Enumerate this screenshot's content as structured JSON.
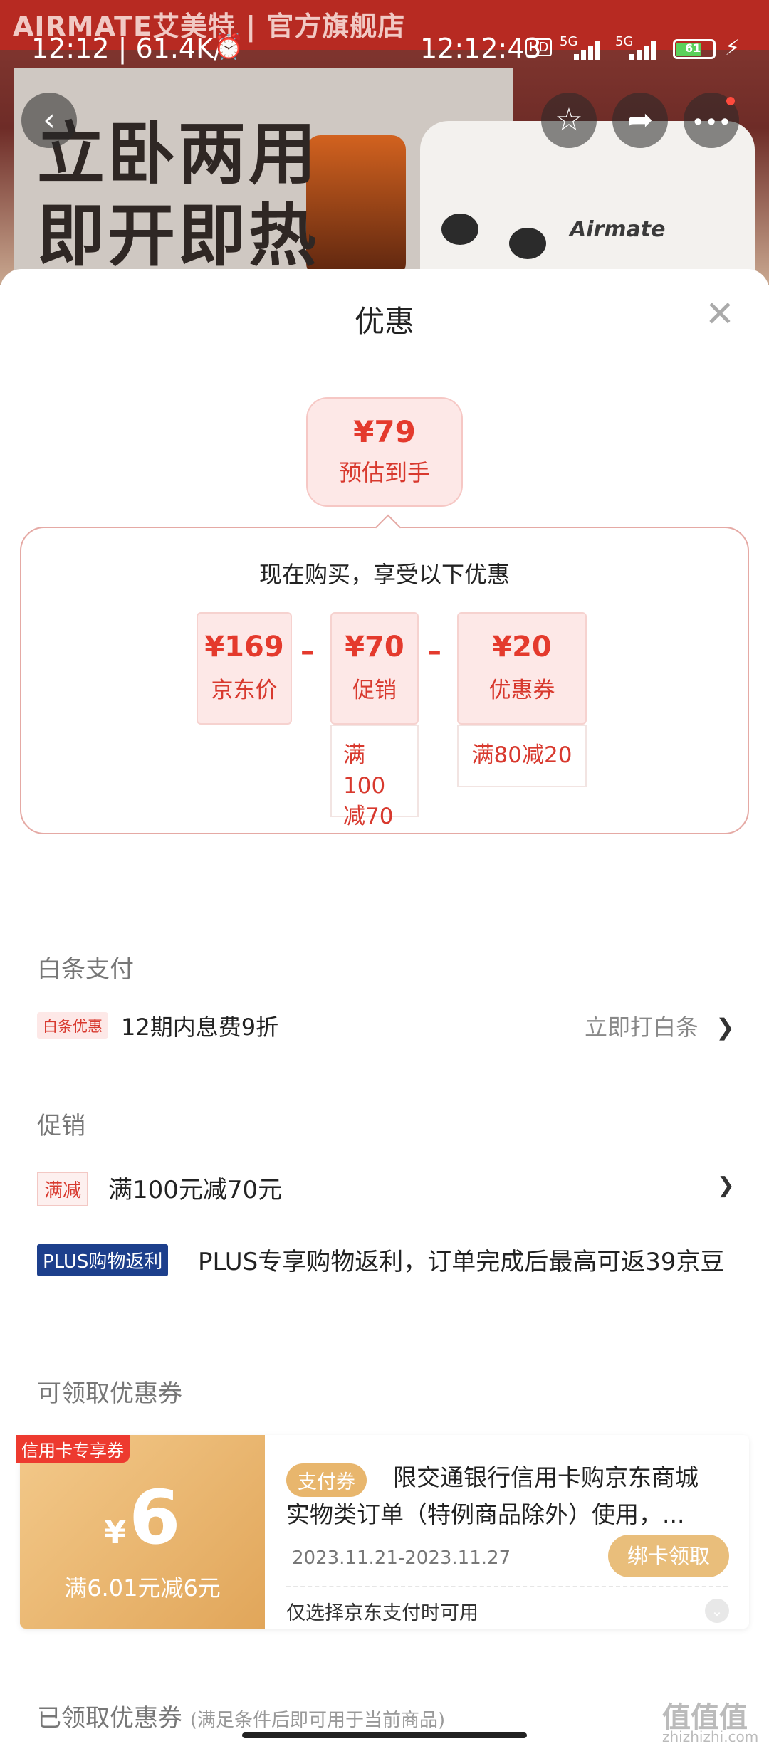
{
  "status_bar": {
    "left_text": "12:12 | 61.4K/s",
    "time": "12:12:43",
    "hd": "HD",
    "sig1": "5G",
    "sig2": "5G",
    "battery": "61"
  },
  "hero": {
    "brand": "AIRMATE艾美特 | 官方旗舰店",
    "slogan_line1": "立卧两用",
    "slogan_line2": "即开即热",
    "heater_brand": "Airmate"
  },
  "sheet": {
    "title": "优惠",
    "estimate": {
      "value": "¥79",
      "label": "预估到手"
    },
    "panel_heading": "现在购买，享受以下优惠",
    "chips": [
      {
        "value": "¥169",
        "label": "京东价"
      },
      {
        "value": "¥70",
        "label": "促销",
        "sub": "满100减70"
      },
      {
        "value": "¥20",
        "label": "优惠券",
        "sub": "满80减20"
      }
    ],
    "baitiao": {
      "heading": "白条支付",
      "tag": "白条优惠",
      "text": "12期内息费9折",
      "action": "立即打白条"
    },
    "promo": {
      "heading": "促销",
      "row1_tag": "满减",
      "row1_text": "满100元减70元",
      "row2_tag": "PLUS购物返利",
      "row2_text": "PLUS专享购物返利，订单完成后最高可返39京豆"
    },
    "coupons": {
      "heading": "可领取优惠券",
      "card_tag": "信用卡专享券",
      "amount": "6",
      "currency": "¥",
      "condition": "满6.01元减6元",
      "pay_tag": "支付券",
      "description": "限交通银行信用卡购京东商城实物类订单（特例商品除外）使用，...",
      "date_range": "2023.11.21-2023.11.27",
      "claim_button": "绑卡领取",
      "note": "仅选择京东支付时可用"
    },
    "claimed": {
      "heading": "已领取优惠券",
      "hint": "(满足条件后即可用于当前商品)"
    }
  },
  "watermark": {
    "main": "值值值",
    "sub": "zhizhizhi.com"
  }
}
